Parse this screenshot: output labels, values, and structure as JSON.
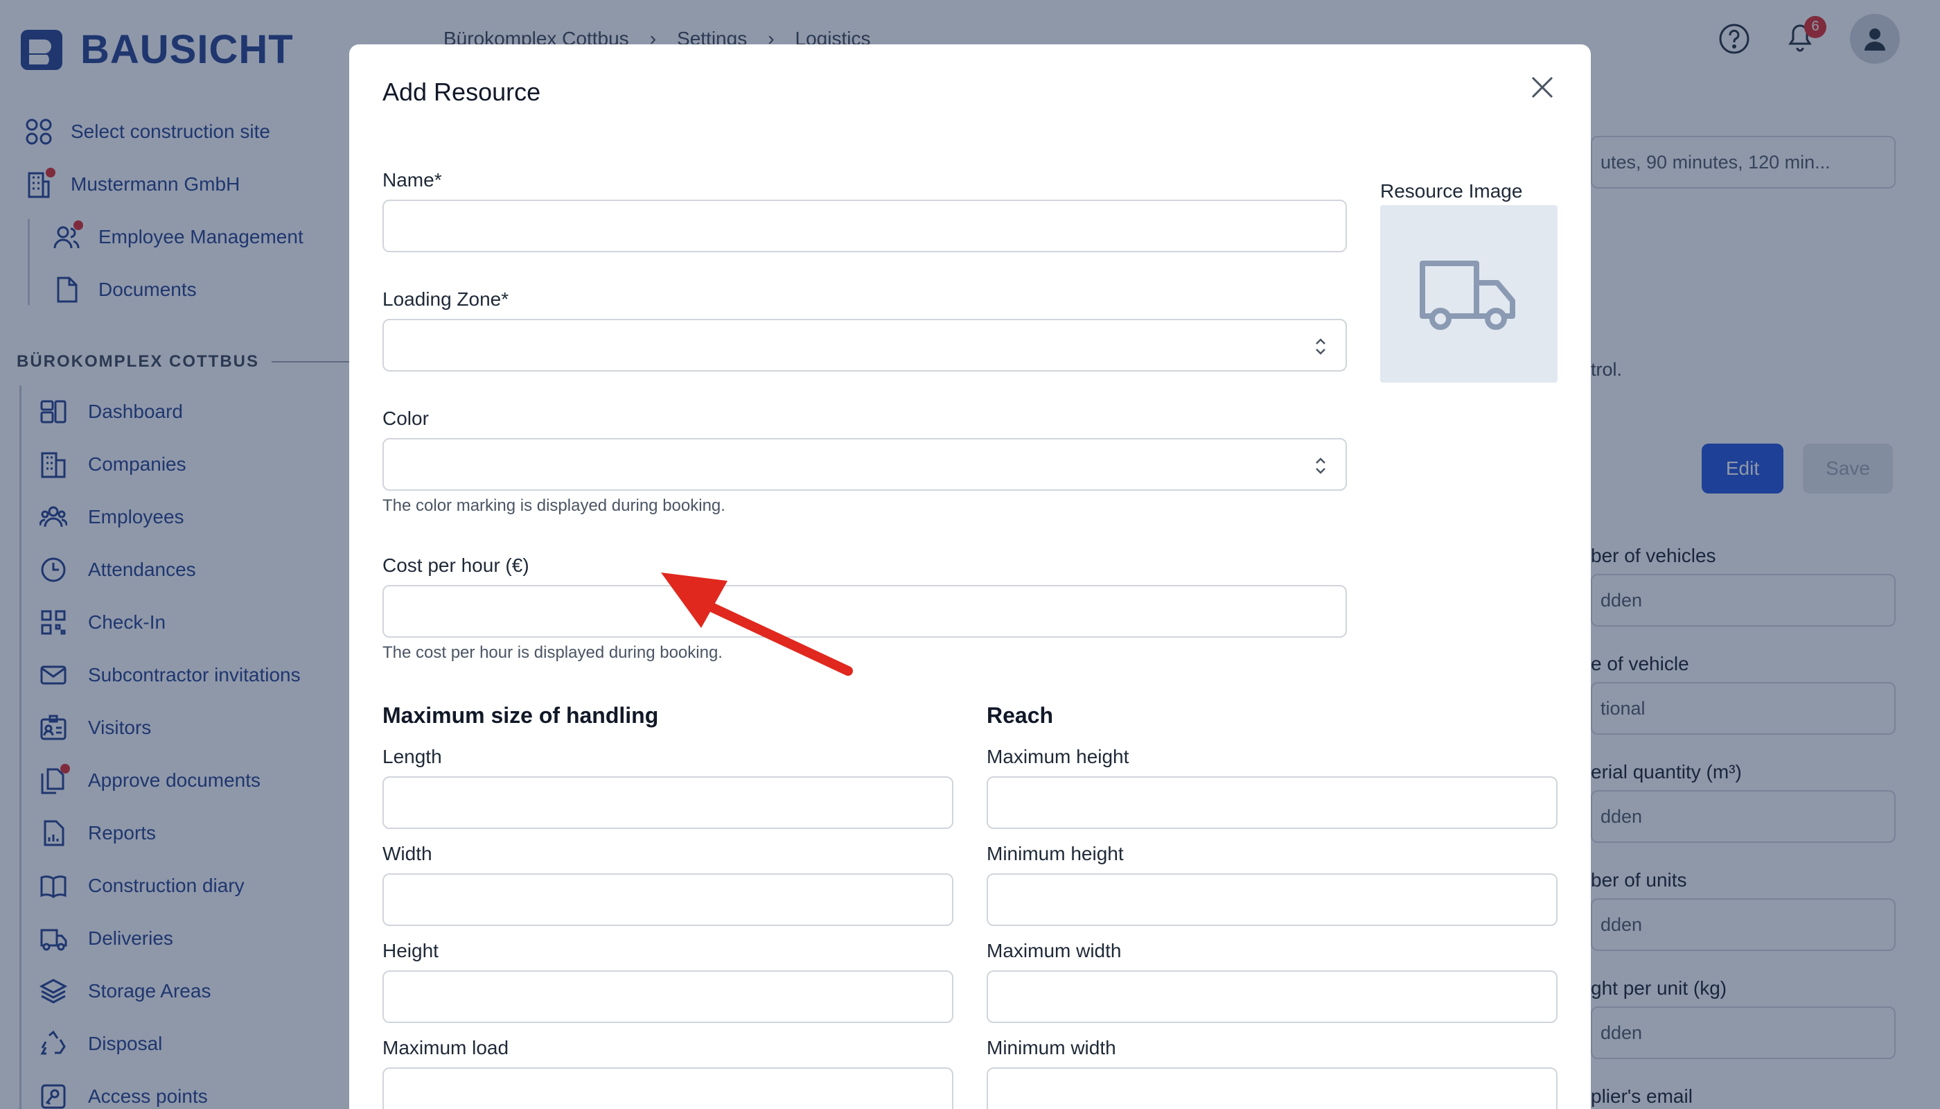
{
  "app": {
    "brand": "BAUSICHT",
    "top_links": [
      {
        "label": "Select construction site",
        "icon": "grid-icon"
      },
      {
        "label": "Mustermann GmbH",
        "icon": "building-icon"
      }
    ],
    "company_links": [
      {
        "label": "Employee Management",
        "icon": "users-icon"
      },
      {
        "label": "Documents",
        "icon": "document-icon"
      }
    ],
    "site_label": "BÜROKOMPLEX COTTBUS",
    "nav": [
      {
        "label": "Dashboard",
        "icon": "dashboard-icon"
      },
      {
        "label": "Companies",
        "icon": "building-icon"
      },
      {
        "label": "Employees",
        "icon": "users-icon"
      },
      {
        "label": "Attendances",
        "icon": "clock-icon"
      },
      {
        "label": "Check-In",
        "icon": "qr-icon"
      },
      {
        "label": "Subcontractor invitations",
        "icon": "mail-icon"
      },
      {
        "label": "Visitors",
        "icon": "badge-icon"
      },
      {
        "label": "Approve documents",
        "icon": "documents-icon"
      },
      {
        "label": "Reports",
        "icon": "report-icon"
      },
      {
        "label": "Construction diary",
        "icon": "book-icon"
      },
      {
        "label": "Deliveries",
        "icon": "truck-icon"
      },
      {
        "label": "Storage Areas",
        "icon": "layers-icon"
      },
      {
        "label": "Disposal",
        "icon": "recycle-icon"
      },
      {
        "label": "Access points",
        "icon": "key-icon"
      }
    ],
    "breadcrumb": [
      "Bürokomplex Cottbus",
      "Settings",
      "Logistics"
    ],
    "notification_count": "6",
    "right_panel": {
      "slot_select": "utes, 90 minutes, 120 min...",
      "control_text": "trol.",
      "edit_label": "Edit",
      "save_label": "Save",
      "fields": [
        {
          "label": "ber of vehicles",
          "value": "dden"
        },
        {
          "label": "e of vehicle",
          "value": "tional"
        },
        {
          "label": "erial quantity (m³)",
          "value": "dden"
        },
        {
          "label": "ber of units",
          "value": "dden"
        },
        {
          "label": "ght per unit (kg)",
          "value": "dden"
        },
        {
          "label": "plier's email",
          "value": ""
        }
      ]
    }
  },
  "modal": {
    "title": "Add Resource",
    "name": {
      "label": "Name*",
      "value": ""
    },
    "loading_zone": {
      "label": "Loading Zone*",
      "value": ""
    },
    "color": {
      "label": "Color",
      "value": "",
      "help": "The color marking is displayed during booking."
    },
    "cost": {
      "label": "Cost per hour (€)",
      "value": "",
      "help": "The cost per hour is displayed during booking."
    },
    "resource_image_label": "Resource Image",
    "handling": {
      "title": "Maximum size of handling",
      "fields": [
        "Length",
        "Width",
        "Height",
        "Maximum load"
      ]
    },
    "reach": {
      "title": "Reach",
      "fields": [
        "Maximum height",
        "Minimum height",
        "Maximum width",
        "Minimum width"
      ]
    }
  }
}
